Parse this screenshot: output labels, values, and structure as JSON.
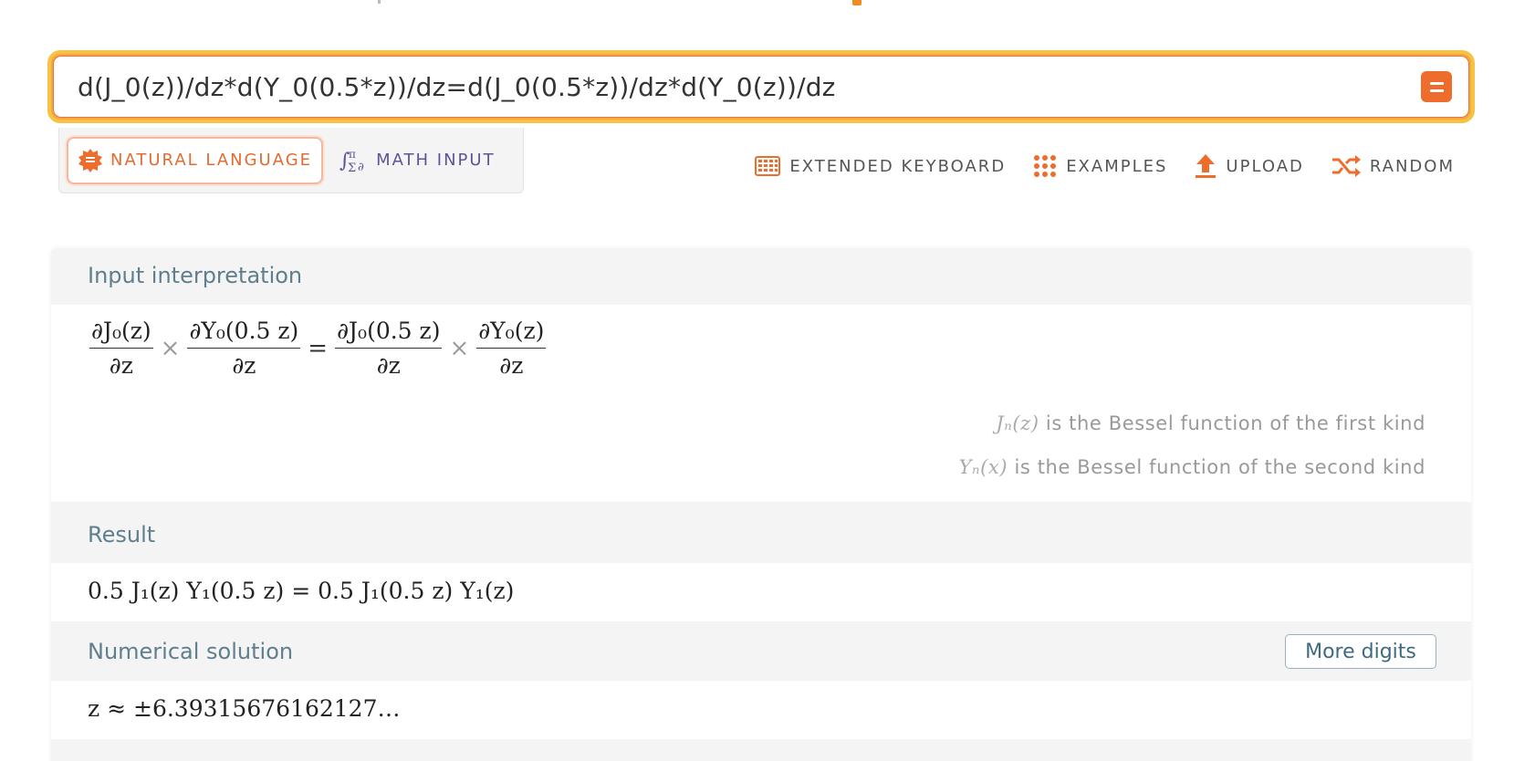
{
  "search": {
    "value": "d(J_0(z))/dz*d(Y_0(0.5*z))/dz=d(J_0(0.5*z))/dz*d(Y_0(z))/dz"
  },
  "modes": [
    {
      "label": "NATURAL LANGUAGE",
      "icon": "natural-language-icon",
      "active": true
    },
    {
      "label": "MATH INPUT",
      "icon": "math-input-icon",
      "active": false
    }
  ],
  "tools": [
    {
      "label": "EXTENDED KEYBOARD",
      "icon": "keyboard-icon"
    },
    {
      "label": "EXAMPLES",
      "icon": "examples-grid-icon"
    },
    {
      "label": "UPLOAD",
      "icon": "upload-icon"
    },
    {
      "label": "RANDOM",
      "icon": "random-shuffle-icon"
    }
  ],
  "pods": {
    "input": {
      "title": "Input interpretation",
      "frac1_num": "∂J₀(z)",
      "frac1_den": "∂z",
      "times1": "×",
      "frac2_num": "∂Y₀(0.5 z)",
      "frac2_den": "∂z",
      "equals": "=",
      "frac3_num": "∂J₀(0.5 z)",
      "frac3_den": "∂z",
      "times2": "×",
      "frac4_num": "∂Y₀(z)",
      "frac4_den": "∂z",
      "note1_symbol": "Jₙ(z)",
      "note1_text": "is the Bessel function of the first kind",
      "note2_symbol": "Yₙ(x)",
      "note2_text": "is the Bessel function of the second kind"
    },
    "result": {
      "title": "Result",
      "expression": "0.5 J₁(z) Y₁(0.5 z) = 0.5 J₁(0.5 z) Y₁(z)"
    },
    "numerical": {
      "title": "Numerical solution",
      "button": "More digits",
      "expression": "z ≈ ±6.39315676162127…"
    }
  },
  "colors": {
    "accent": "#ee6d2d",
    "search_border": "#f7c341",
    "pod_title": "#5f7e8e",
    "math_input": "#5b5597"
  }
}
